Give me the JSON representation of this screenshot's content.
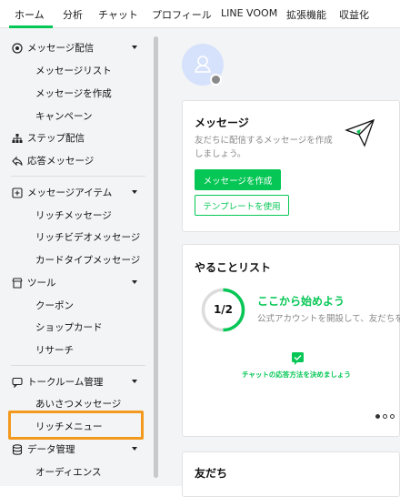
{
  "tabs": [
    {
      "label": "ホーム",
      "active": true
    },
    {
      "label": "分析"
    },
    {
      "label": "チャット"
    },
    {
      "label": "プロフィール"
    },
    {
      "label": "LINE VOOM"
    },
    {
      "label": "拡張機能"
    },
    {
      "label": "収益化"
    }
  ],
  "sidebar": {
    "message_delivery": {
      "label": "メッセージ配信",
      "items": [
        "メッセージリスト",
        "メッセージを作成",
        "キャンペーン"
      ]
    },
    "step_delivery": "ステップ配信",
    "auto_reply": "応答メッセージ",
    "message_items": {
      "label": "メッセージアイテム",
      "items": [
        "リッチメッセージ",
        "リッチビデオメッセージ",
        "カードタイプメッセージ"
      ]
    },
    "tools": {
      "label": "ツール",
      "items": [
        "クーポン",
        "ショップカード",
        "リサーチ"
      ]
    },
    "chatroom": {
      "label": "トークルーム管理",
      "items": [
        "あいさつメッセージ",
        "リッチメニュー"
      ]
    },
    "data_mgmt": {
      "label": "データ管理",
      "items": [
        "オーディエンス"
      ]
    }
  },
  "main": {
    "message_card": {
      "title": "メッセージ",
      "desc_line1": "友だちに配信するメッセージを作成",
      "desc_line2": "しましょう。",
      "create_button": "メッセージを作成",
      "template_button": "テンプレートを使用"
    },
    "todo_card": {
      "title": "やることリスト",
      "progress_text": "1/2",
      "progress": 0.5,
      "start_title": "ここから始めよう",
      "start_desc": "公式アカウントを開設して、友だちを",
      "task_label": "チャットの応答方法を決めましょう"
    },
    "friends_card": {
      "title": "友だち"
    }
  },
  "colors": {
    "accent": "#06c755",
    "highlight": "#f39a1e",
    "sidebar_bg": "#f3f4f6"
  }
}
